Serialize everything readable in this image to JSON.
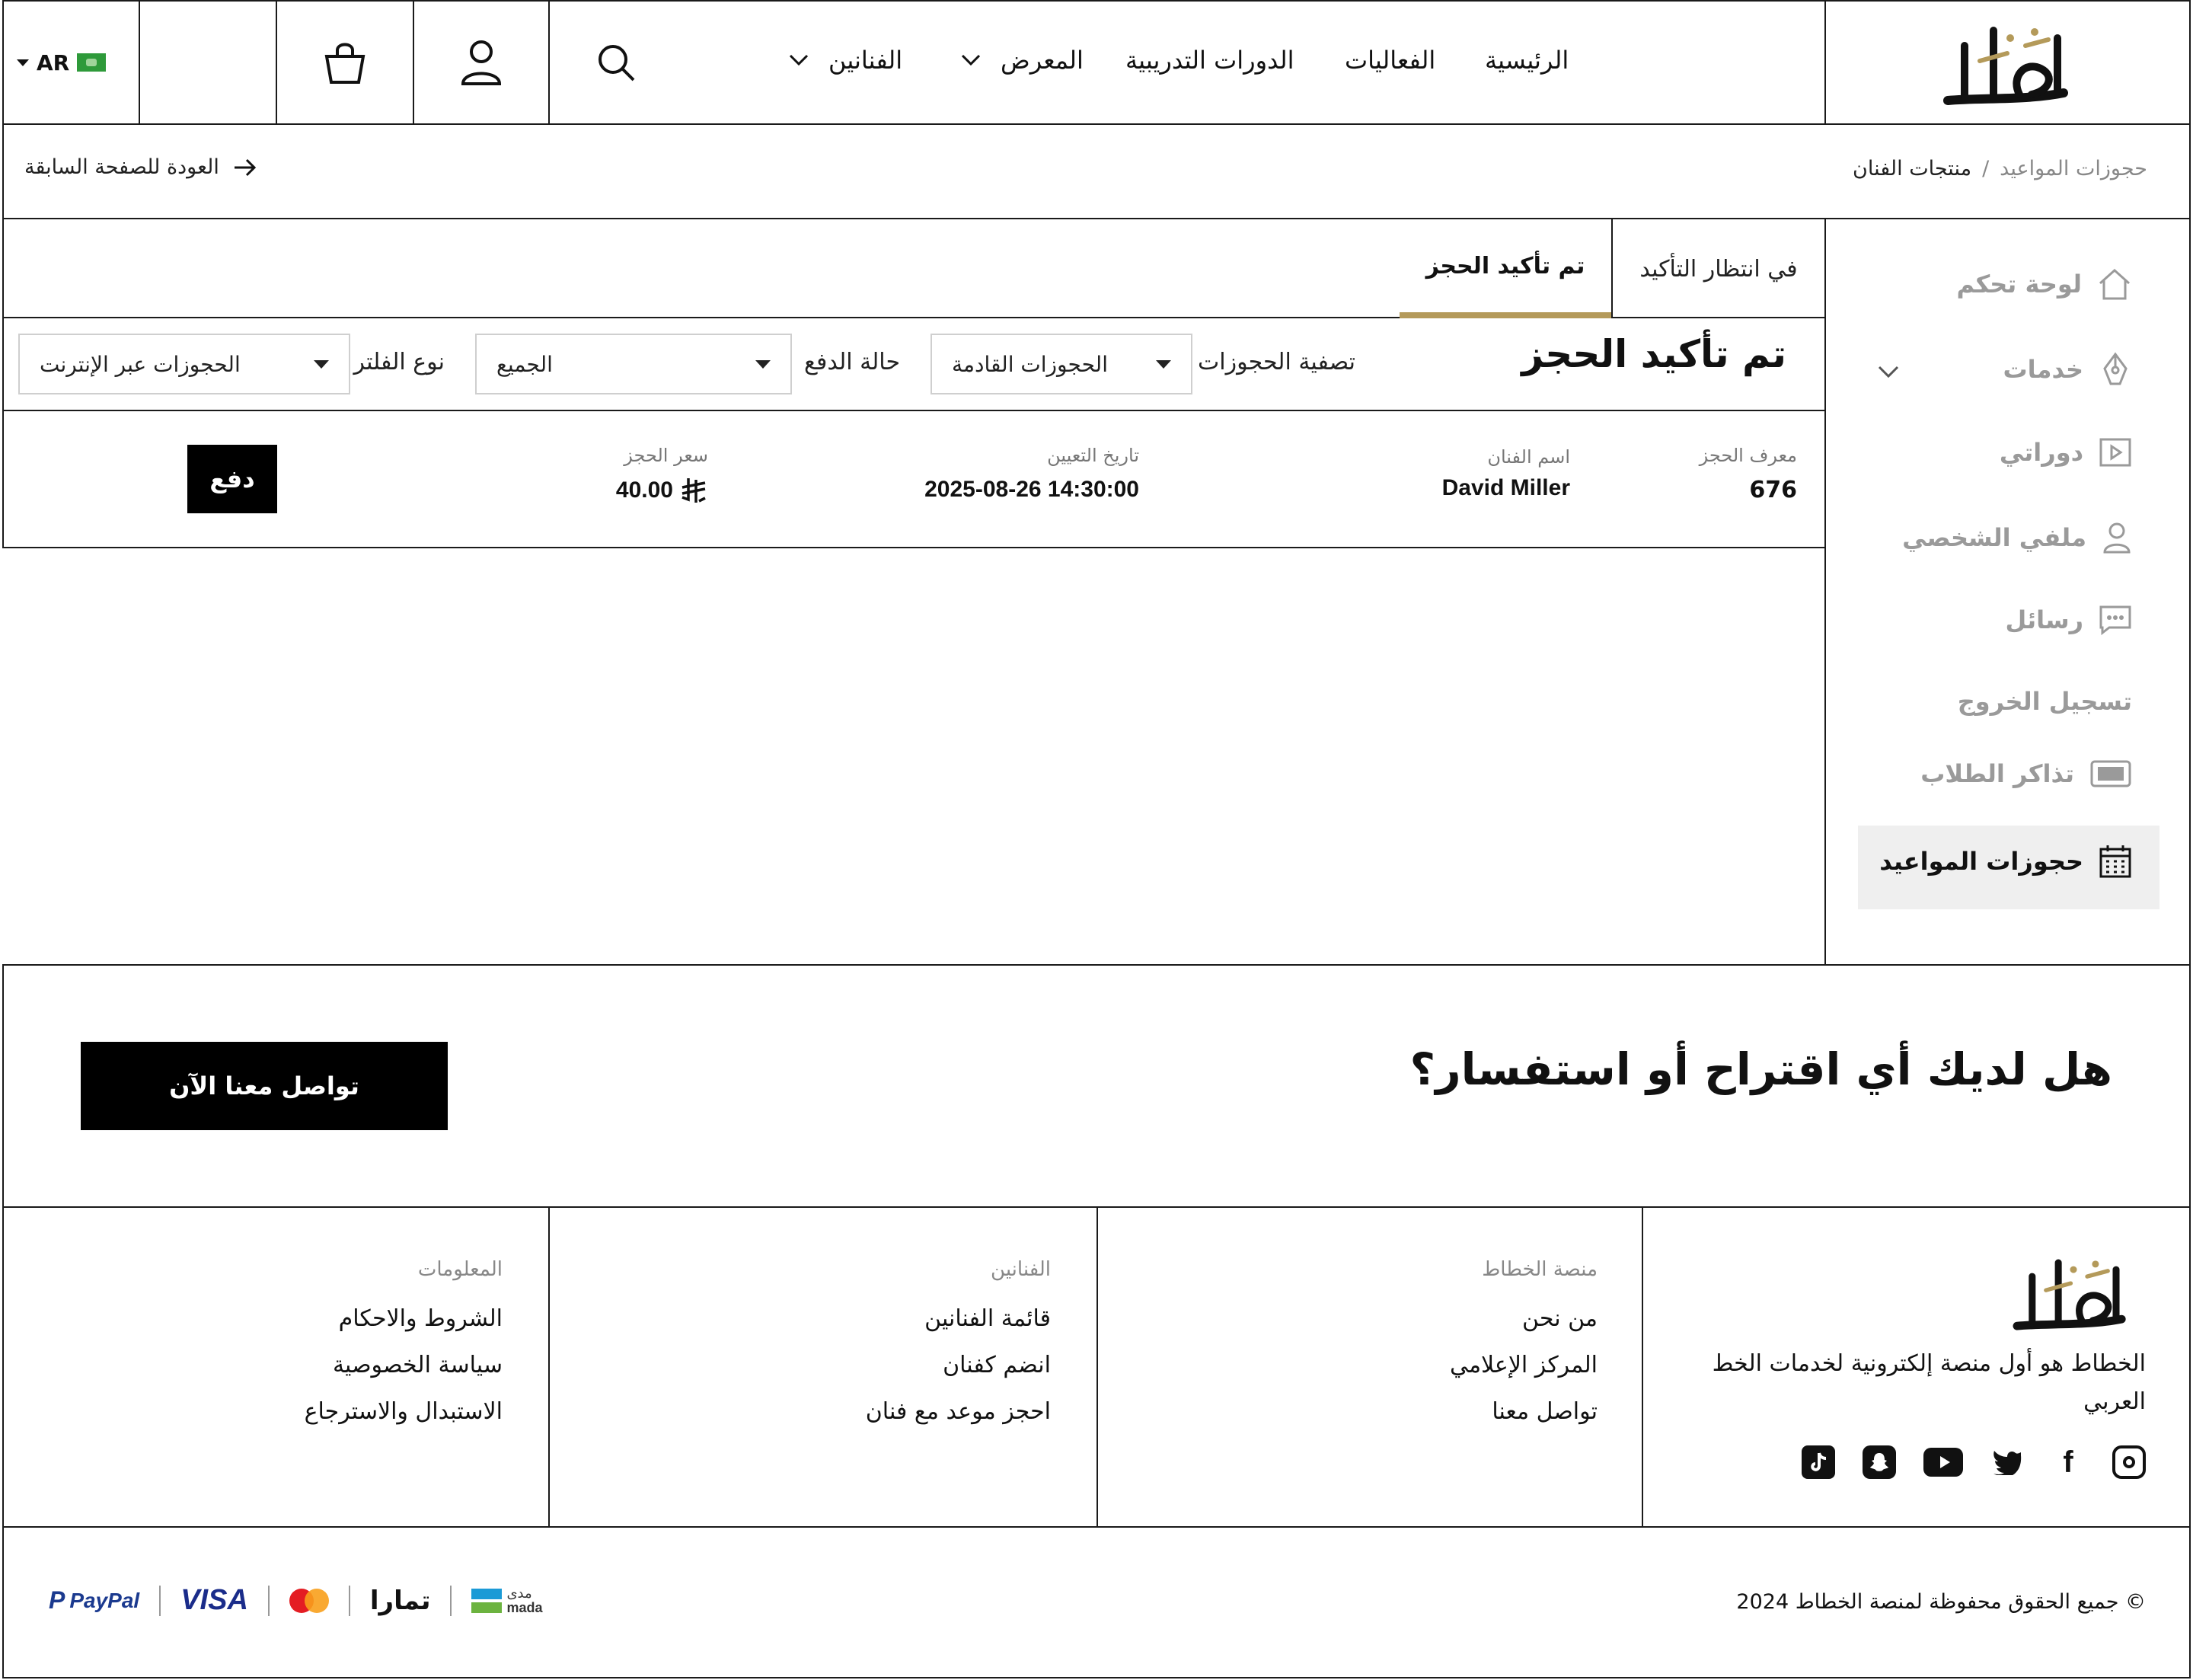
{
  "header": {
    "nav": [
      {
        "label": "الرئيسية"
      },
      {
        "label": "الفعاليات"
      },
      {
        "label": "الدورات التدريبية"
      },
      {
        "label": "المعرض"
      },
      {
        "label": "الفنانين"
      }
    ],
    "lang": "AR",
    "logo_icon": "khattat-calligraphy-logo",
    "brand_gold": "#b49a5a"
  },
  "breadcrumb": {
    "items": [
      "حجوزات المواعيد",
      "منتجات الفنان"
    ],
    "separator": "/",
    "back_label": "العودة للصفحة السابقة"
  },
  "sidebar": {
    "items": [
      {
        "label": "لوحة تحكم",
        "icon": "home-icon"
      },
      {
        "label": "خدمات",
        "icon": "pen-nib-icon"
      },
      {
        "label": "دوراتي",
        "icon": "play-icon"
      },
      {
        "label": "ملفي الشخصي",
        "icon": "user-icon"
      },
      {
        "label": "رسائل",
        "icon": "chat-icon"
      },
      {
        "label": "تسجيل الخروج",
        "icon": ""
      },
      {
        "label": "تذاكر الطلاب",
        "icon": "ticket-icon"
      },
      {
        "label": "حجوزات المواعيد",
        "icon": "calendar-icon"
      }
    ],
    "active": "حجوزات المواعيد"
  },
  "tabs": [
    {
      "label": "في انتظار التأكيد"
    },
    {
      "label": "تم تأكيد الحجز"
    }
  ],
  "main": {
    "title": "تم تأكيد الحجز",
    "filters": {
      "booking_filter_label": "تصفية الحجوزات",
      "booking_filter_value": "الحجوزات القادمة",
      "payment_label": "حالة الدفع",
      "payment_value": "الجميع",
      "type_label": "نوع الفلتر",
      "type_value": "الحجوزات عبر الإنترنت"
    },
    "booking": {
      "id_label": "معرف الحجز",
      "id_value": "676",
      "artist_label": "اسم الفنان",
      "artist_value": "David Miller",
      "date_label": "تاريخ التعيين",
      "date_value": "2025-08-26 14:30:00",
      "price_label": "سعر الحجز",
      "price_value": "40.00",
      "pay_label": "دفع"
    }
  },
  "cta": {
    "question": "هل لديك أي اقتراح أو استفسار؟",
    "button": "تواصل معنا الآن"
  },
  "footer": {
    "tagline": "الخطاط هو أول منصة إلكترونية لخدمات الخط العربي",
    "columns": [
      {
        "title": "منصة الخطاط",
        "links": [
          "من نحن",
          "المركز الإعلامي",
          "تواصل معنا"
        ]
      },
      {
        "title": "الفنانين",
        "links": [
          "قائمة الفنانين",
          "انضم كفنان",
          "احجز موعد مع فنان"
        ]
      },
      {
        "title": "المعلومات",
        "links": [
          "الشروط والاحكام",
          "سياسة الخصوصية",
          "الاستبدال والاسترجاع"
        ]
      }
    ],
    "social": [
      "instagram-icon",
      "facebook-icon",
      "twitter-icon",
      "youtube-icon",
      "snapchat-icon",
      "tiktok-icon"
    ],
    "copyright": "© جميع الحقوق محفوظة لمنصة الخطاط 2024",
    "payments": {
      "mada_ar": "مدى",
      "mada_en": "mada",
      "tamara": "تمارا",
      "visa": "VISA",
      "paypal": "PayPal"
    }
  }
}
